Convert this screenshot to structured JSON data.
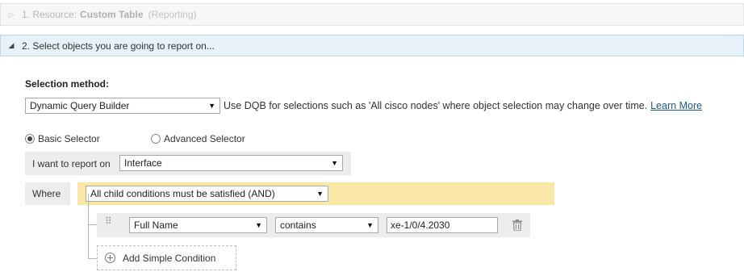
{
  "step1": {
    "toggle": "▷",
    "prefix": "1. Resource:",
    "name": "Custom Table",
    "suffix": "(Reporting)"
  },
  "step2": {
    "toggle": "◢",
    "title": "2. Select objects you are going to report on..."
  },
  "selection_method": {
    "label": "Selection method:",
    "value": "Dynamic Query Builder",
    "hint": "Use DQB for selections such as 'All cisco nodes' where object selection may change over time.",
    "learn_more": "Learn More"
  },
  "selector_mode": {
    "basic": "Basic Selector",
    "advanced": "Advanced Selector",
    "selected": "basic"
  },
  "report_on": {
    "label": "I want to report on",
    "value": "Interface"
  },
  "where": {
    "label": "Where",
    "condition_mode": "All child conditions must be satisfied (AND)"
  },
  "condition": {
    "field": "Full Name",
    "operator": "contains",
    "value": "xe-1/0/4.2030"
  },
  "add_condition": {
    "label": "Add Simple Condition"
  },
  "icons": {
    "caret": "▼",
    "grip": "⠿",
    "trash": "trash-icon",
    "add": "plus-circle-icon"
  },
  "colors": {
    "section_active_bg": "#e6f2f7",
    "where_highlight": "#fbe8a6",
    "link": "#1a5c8a"
  }
}
